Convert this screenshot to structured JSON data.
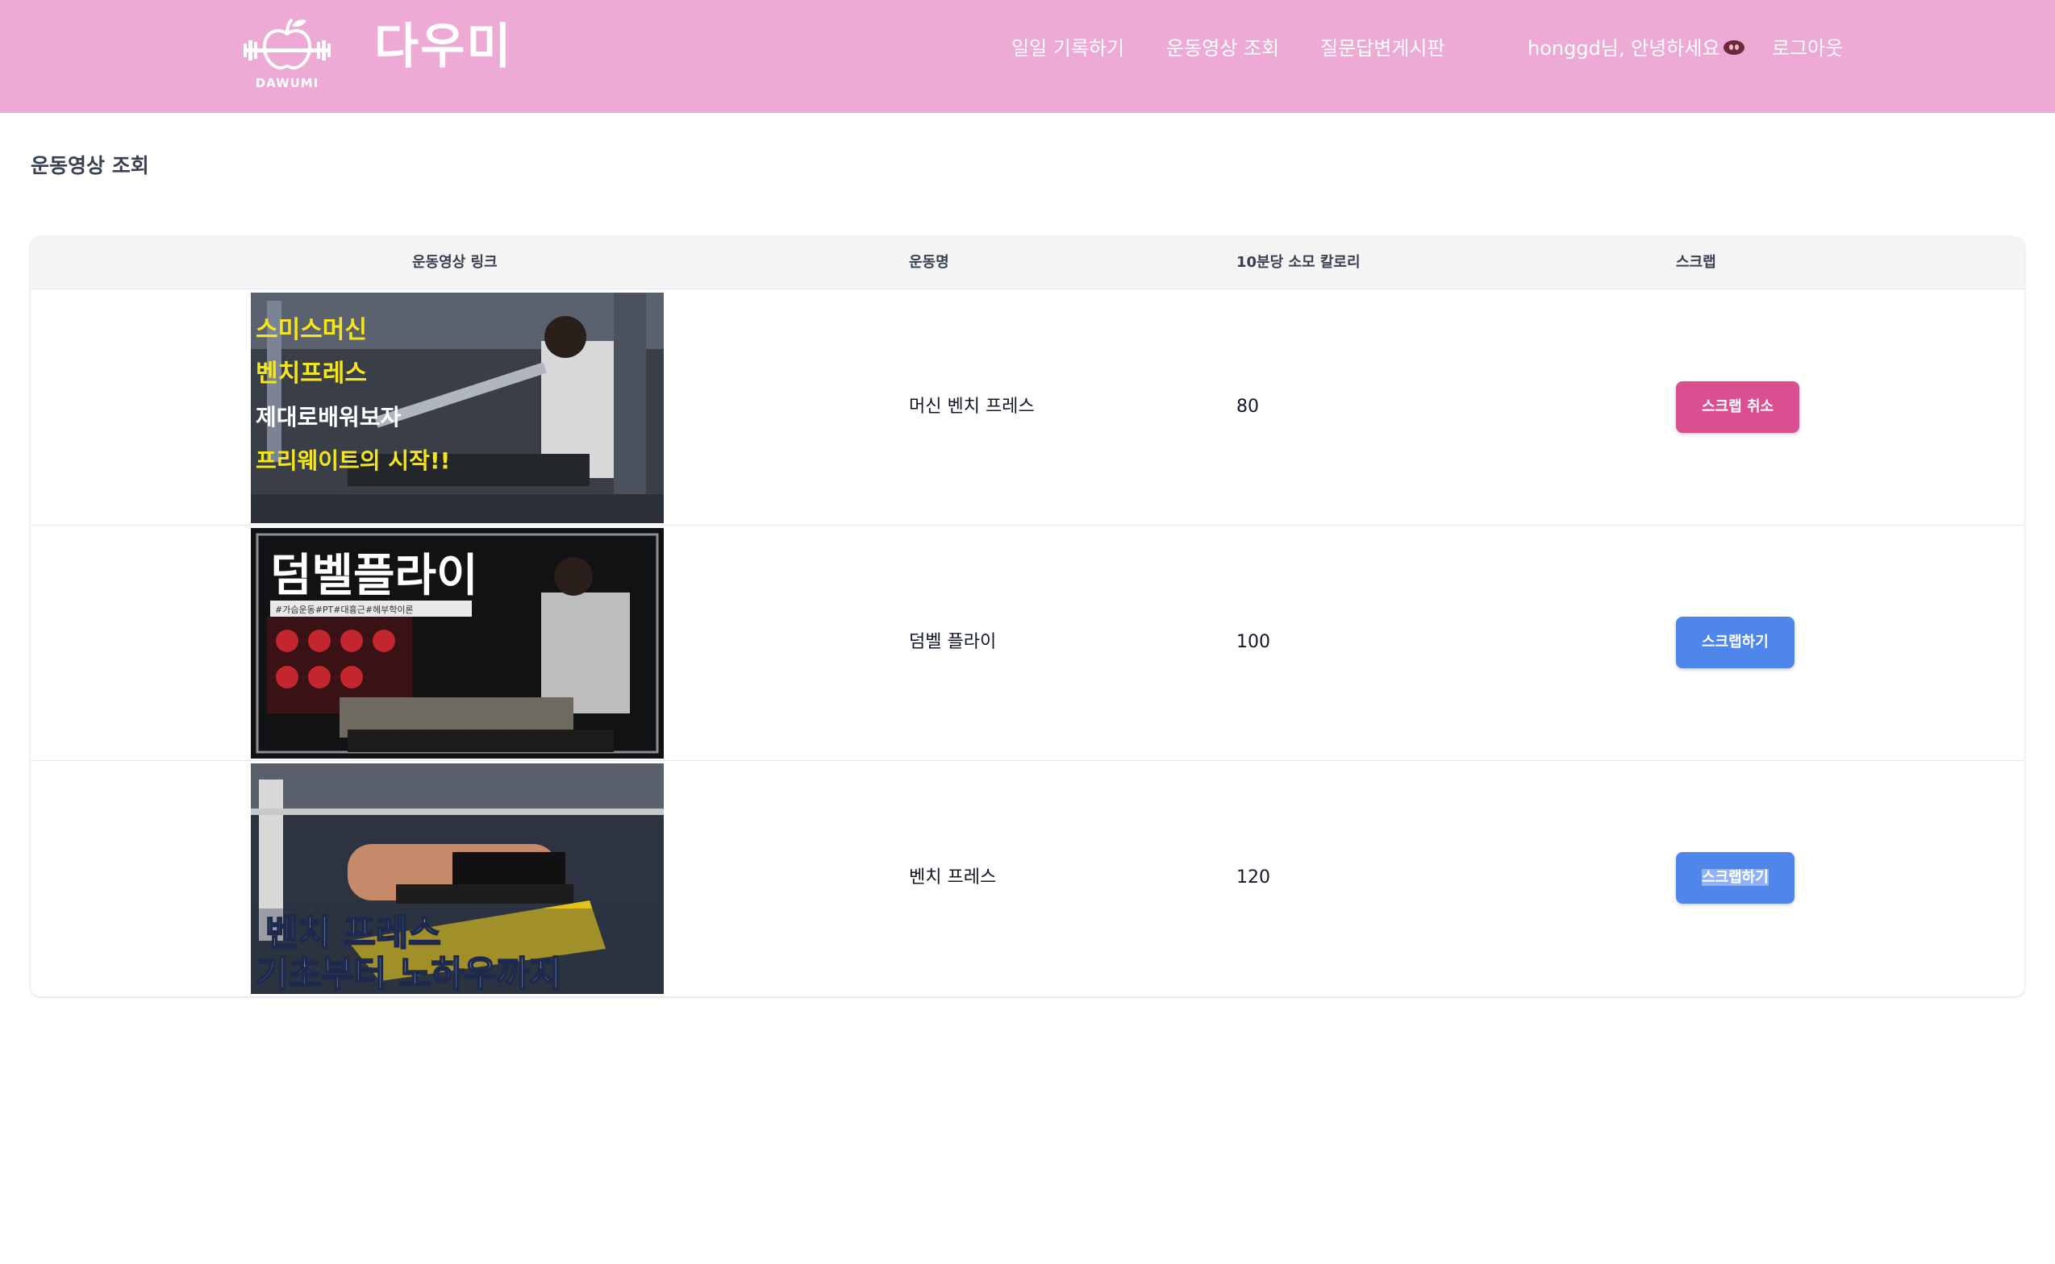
{
  "header": {
    "logo_caption": "DAWUMI",
    "brand": "다우미",
    "nav": {
      "daily_log": "일일 기록하기",
      "video_browse": "운동영상 조회",
      "qna_board": "질문답변게시판",
      "greeting": "honggd님, 안녕하세요",
      "logout": "로그아웃"
    },
    "colors": {
      "background": "#ecaad5",
      "text": "#ffffff"
    }
  },
  "page": {
    "title": "운동영상 조회"
  },
  "table": {
    "columns": {
      "video_link": "운동영상 링크",
      "exercise_name": "운동명",
      "calories": "10분당 소모 칼로리",
      "scrap": "스크랩"
    },
    "rows": [
      {
        "thumbnail_lines": [
          "스미스머신",
          "벤치프레스",
          "제대로배워보자",
          "프리웨이트의 시작!!"
        ],
        "exercise_name": "머신 벤치 프레스",
        "calories": "80",
        "button_label": "스크랩 취소",
        "scrapped": true
      },
      {
        "thumbnail_lines": [
          "덤벨플라이",
          "#가슴운동#PT#대흉근#헤부학이론"
        ],
        "exercise_name": "덤벨 플라이",
        "calories": "100",
        "button_label": "스크랩하기",
        "scrapped": false
      },
      {
        "thumbnail_lines": [
          "벤치 프레스",
          "기초부터 노하우까지"
        ],
        "exercise_name": "벤치 프레스",
        "calories": "120",
        "button_label": "스크랩하기",
        "scrapped": false
      }
    ]
  },
  "colors": {
    "scrap_cancel_button": "#d94f8f",
    "scrap_button": "#4f86ec"
  },
  "icons": {
    "logo": "apple-barbell-icon",
    "greeting_emoji": "pig-nose-icon"
  }
}
